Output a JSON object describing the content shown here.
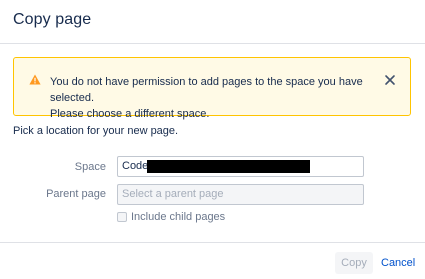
{
  "dialog": {
    "title": "Copy page"
  },
  "warning": {
    "icon": "warning-icon",
    "line1": "You do not have permission to add pages to the space you have selected.",
    "line2": "Please choose a different space.",
    "close_icon": "close-icon",
    "accent_color": "#ffc400",
    "background_color": "#fffae6"
  },
  "form": {
    "location_label": "Pick a location for your new page.",
    "space": {
      "label": "Space",
      "value": "Code"
    },
    "parent_page": {
      "label": "Parent page",
      "placeholder": "Select a parent page"
    },
    "include_child_pages": {
      "label": "Include child pages",
      "checked": false
    }
  },
  "footer": {
    "copy_label": "Copy",
    "copy_enabled": false,
    "cancel_label": "Cancel",
    "link_color": "#0052cc"
  }
}
